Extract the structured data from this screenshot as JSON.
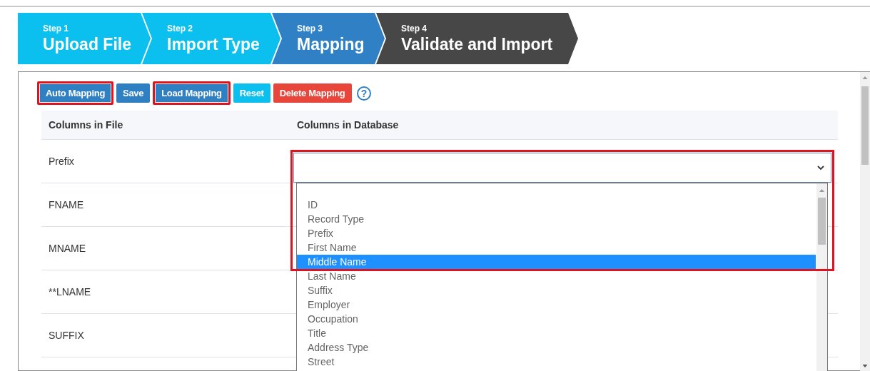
{
  "steps": [
    {
      "number": "Step 1",
      "label": "Upload File",
      "completed": true,
      "selected": false
    },
    {
      "number": "Step 2",
      "label": "Import Type",
      "completed": true,
      "selected": false
    },
    {
      "number": "Step 3",
      "label": "Mapping",
      "completed": false,
      "selected": true
    },
    {
      "number": "Step 4",
      "label": "Validate and Import",
      "completed": false,
      "selected": false
    }
  ],
  "toolbar": {
    "buttons": [
      {
        "label": "Auto Mapping",
        "kind": "primary",
        "highlighted": true
      },
      {
        "label": "Save",
        "kind": "primary",
        "highlighted": false
      },
      {
        "label": "Load Mapping",
        "kind": "primary",
        "highlighted": true
      },
      {
        "label": "Reset",
        "kind": "info",
        "highlighted": false
      },
      {
        "label": "Delete Mapping",
        "kind": "danger",
        "highlighted": false
      }
    ],
    "help": "?"
  },
  "table": {
    "columns": [
      "Columns in File",
      "Columns in Database"
    ],
    "rows": [
      {
        "file_column": "Prefix"
      },
      {
        "file_column": "FNAME"
      },
      {
        "file_column": "MNAME"
      },
      {
        "file_column": "**LNAME"
      },
      {
        "file_column": "SUFFIX"
      }
    ]
  },
  "dropdown": {
    "expanded": true,
    "highlighted": true,
    "options": [
      {
        "label": "ID",
        "selected": false
      },
      {
        "label": "Record Type",
        "selected": false
      },
      {
        "label": "Prefix",
        "selected": false
      },
      {
        "label": "First Name",
        "selected": false
      },
      {
        "label": "Middle Name",
        "selected": true
      },
      {
        "label": "Last Name",
        "selected": false
      },
      {
        "label": "Suffix",
        "selected": false
      },
      {
        "label": "Employer",
        "selected": false
      },
      {
        "label": "Occupation",
        "selected": false
      },
      {
        "label": "Title",
        "selected": false
      },
      {
        "label": "Address Type",
        "selected": false
      },
      {
        "label": "Street",
        "selected": false
      }
    ]
  }
}
